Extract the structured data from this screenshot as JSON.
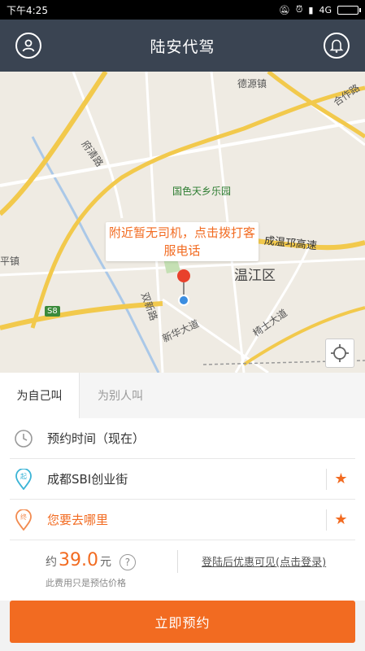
{
  "status": {
    "time": "下午4:25",
    "net": "4G"
  },
  "header": {
    "title": "陆安代驾"
  },
  "map": {
    "labels": {
      "deyuan": "德源镇",
      "hezuo": "合作路",
      "fuqing": "府清路",
      "park": "国色天乡乐园",
      "highway": "成温邛高速",
      "wenjiang": "温江区",
      "ping": "平镇",
      "shuangxin": "双新路",
      "xinhua": "新华大道",
      "qishi": "椅士大道",
      "s8": "S8"
    },
    "tooltip": "附近暂无司机，点击拨打客服电话"
  },
  "tabs": {
    "self": "为自己叫",
    "other": "为别人叫"
  },
  "rows": {
    "time": "预约时间（现在）",
    "start": "成都SBI创业街",
    "dest": "您要去哪里"
  },
  "price": {
    "prefix": "约",
    "amount": "39.0",
    "unit": "元",
    "help": "?",
    "note": "此费用只是预估价格",
    "login": "登陆后优惠可见(点击登录)"
  },
  "actions": {
    "book": "立即预约"
  },
  "colors": {
    "accent": "#f26b21",
    "header": "#3a4452"
  }
}
